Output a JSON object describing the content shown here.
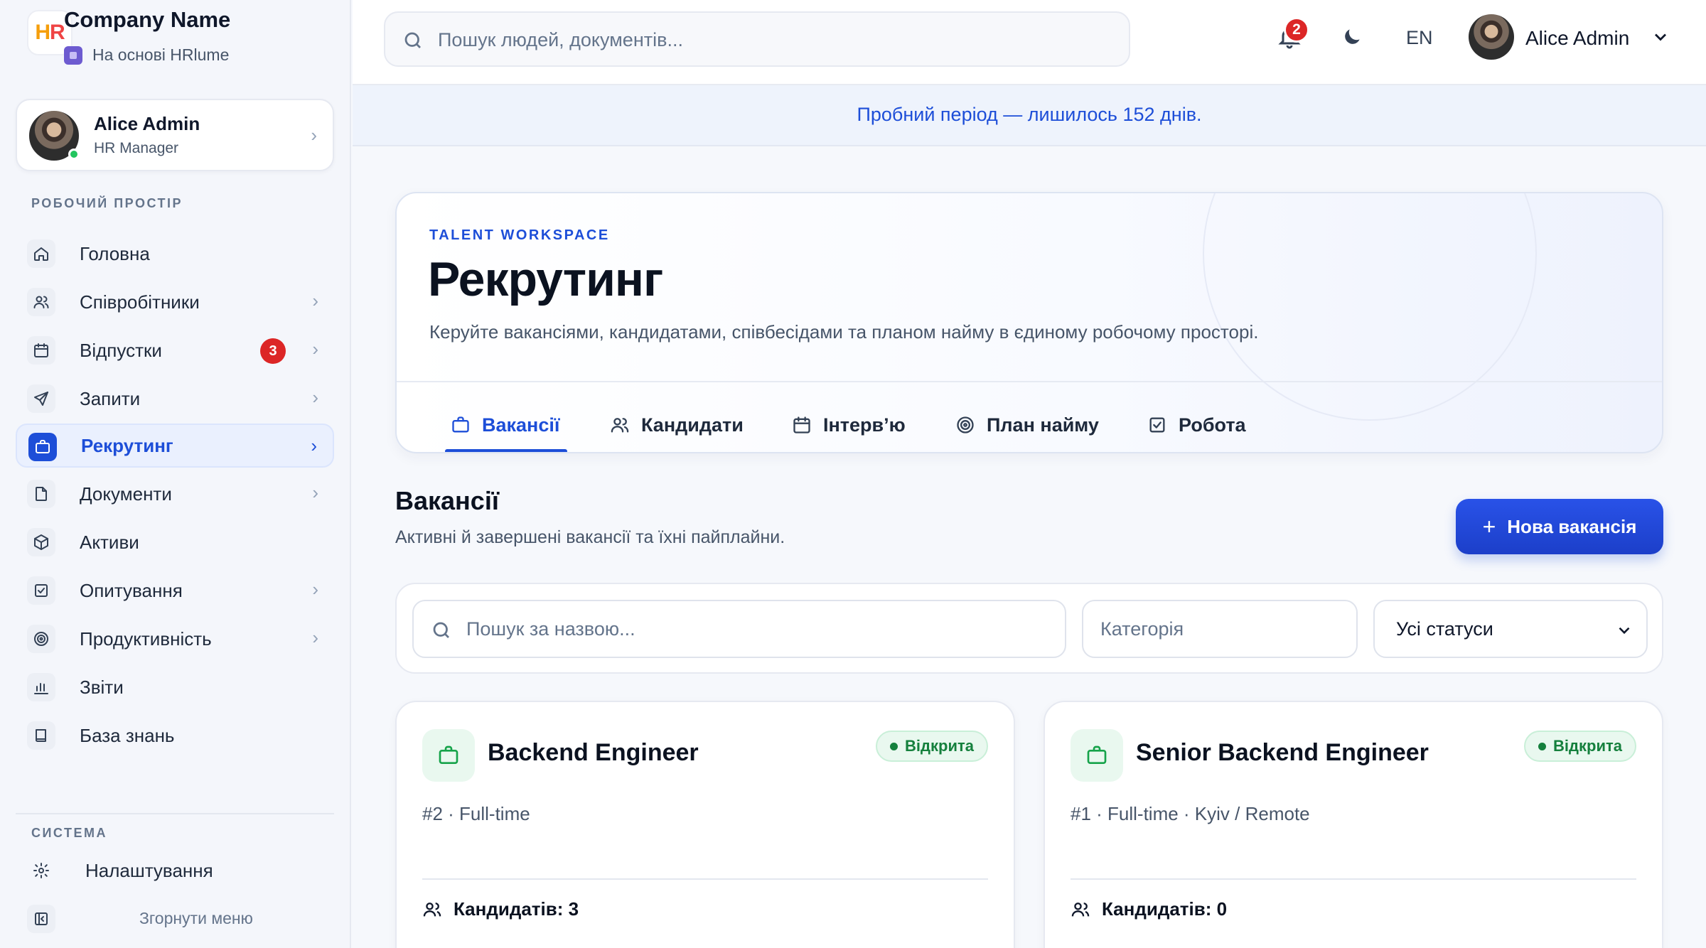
{
  "brand": {
    "logo_text": "HR",
    "company": "Company Name",
    "powered_by": "На основі HRlume"
  },
  "user": {
    "name": "Alice Admin",
    "role": "HR Manager"
  },
  "sidebar": {
    "workspace_label": "РОБОЧИЙ ПРОСТІР",
    "items": [
      {
        "label": "Головна",
        "icon": "home-icon"
      },
      {
        "label": "Співробітники",
        "icon": "users-icon"
      },
      {
        "label": "Відпустки",
        "icon": "calendar-icon",
        "badge": "3"
      },
      {
        "label": "Запити",
        "icon": "send-icon"
      },
      {
        "label": "Рекрутинг",
        "icon": "briefcase-icon",
        "active": true
      },
      {
        "label": "Документи",
        "icon": "file-icon"
      },
      {
        "label": "Активи",
        "icon": "box-icon"
      },
      {
        "label": "Опитування",
        "icon": "checkbox-icon"
      },
      {
        "label": "Продуктивність",
        "icon": "target-icon"
      },
      {
        "label": "Звіти",
        "icon": "bar-chart-icon"
      },
      {
        "label": "База знань",
        "icon": "book-icon"
      }
    ],
    "system_label": "СИСТЕМА",
    "settings_label": "Налаштування",
    "collapse_label": "Згорнути меню"
  },
  "topbar": {
    "search_placeholder": "Пошук людей, документів...",
    "notifications_count": "2",
    "language": "EN",
    "user_name": "Alice Admin"
  },
  "trial": {
    "text": "Пробний період — лишилось 152 днів."
  },
  "hero": {
    "eyebrow": "TALENT WORKSPACE",
    "title": "Рекрутинг",
    "description": "Керуйте вакансіями, кандидатами, співбесідами та планом найму в єдиному робочому просторі.",
    "tabs": [
      {
        "label": "Вакансії",
        "icon": "briefcase-icon",
        "active": true
      },
      {
        "label": "Кандидати",
        "icon": "users-icon"
      },
      {
        "label": "Інтерв’ю",
        "icon": "calendar-icon"
      },
      {
        "label": "План найму",
        "icon": "target-icon"
      },
      {
        "label": "Робота",
        "icon": "checkbox-icon"
      }
    ]
  },
  "section": {
    "title": "Вакансії",
    "description": "Активні й завершені вакансії та їхні пайплайни.",
    "new_button": "Нова вакансія"
  },
  "filters": {
    "search_placeholder": "Пошук за назвою...",
    "category_placeholder": "Категорія",
    "status_value": "Усі статуси"
  },
  "jobs": [
    {
      "title": "Backend Engineer",
      "status": "Відкрита",
      "meta": "#2 · Full-time",
      "candidates": "Кандидатів: 3"
    },
    {
      "title": "Senior Backend Engineer",
      "status": "Відкрита",
      "meta": "#1 · Full-time · Kyiv / Remote",
      "candidates": "Кандидатів: 0"
    }
  ],
  "colors": {
    "accent": "#1d4ed8",
    "success": "#15803d",
    "danger": "#dc2626"
  }
}
